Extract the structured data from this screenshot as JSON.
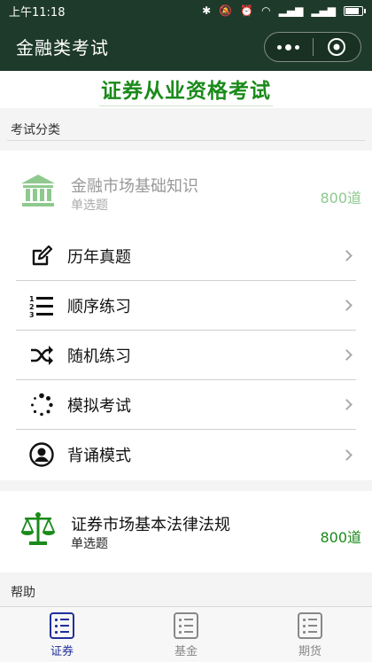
{
  "status_bar": {
    "time": "上午11:18"
  },
  "nav": {
    "title": "金融类考试"
  },
  "banner": {
    "title": "证券从业资格考试"
  },
  "section_exam": {
    "label": "考试分类"
  },
  "categories": [
    {
      "name": "金融市场基础知识",
      "type": "单选题",
      "count": "800道",
      "color": "#8fc98f"
    },
    {
      "name": "证券市场基本法律法规",
      "type": "单选题",
      "count": "800道",
      "color": "#1a8a1a"
    }
  ],
  "menu": [
    {
      "label": "历年真题",
      "icon": "edit-icon"
    },
    {
      "label": "顺序练习",
      "icon": "ordered-list-icon"
    },
    {
      "label": "随机练习",
      "icon": "shuffle-icon"
    },
    {
      "label": "模拟考试",
      "icon": "spinner-icon"
    },
    {
      "label": "背诵模式",
      "icon": "user-circle-icon"
    }
  ],
  "section_help": {
    "label": "帮助"
  },
  "tabs": [
    {
      "label": "证券",
      "active": true
    },
    {
      "label": "基金",
      "active": false
    },
    {
      "label": "期货",
      "active": false
    }
  ],
  "colors": {
    "nav_bg": "#1e3a2a",
    "accent_green": "#1a8a1a",
    "tab_active": "#1f2f9a"
  }
}
